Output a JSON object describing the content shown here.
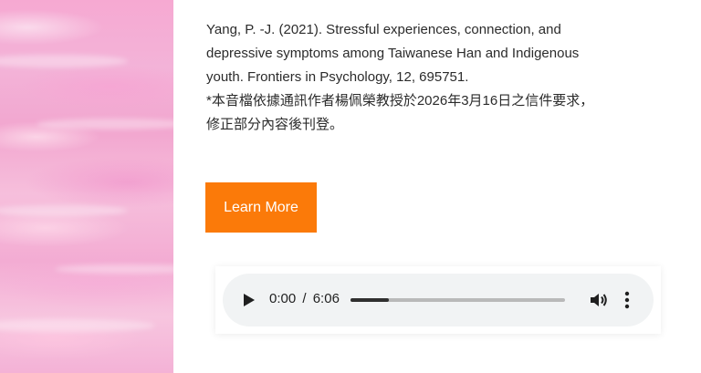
{
  "citation": {
    "line1": "Yang, P. -J. (2021). Stressful experiences, connection, and",
    "line2": "depressive symptoms among Taiwanese Han and Indigenous",
    "line3": "youth. Frontiers in Psychology, 12, 695751.",
    "line4": "*本音檔依據通訊作者楊佩榮教授於2026年3月16日之信件要求，",
    "line5": "修正部分內容後刊登。"
  },
  "learn_more_label": "Learn More",
  "audio": {
    "current_time": "0:00",
    "separator": "/",
    "duration": "6:06",
    "progress_fraction": 0.18,
    "play_icon": "play-icon",
    "volume_icon": "volume-icon",
    "menu_icon": "more-vertical-icon"
  },
  "colors": {
    "button_bg": "#fb7a09",
    "button_text": "#ffffff",
    "text": "#2b2b2b",
    "player_bg": "#f1f3f4"
  }
}
